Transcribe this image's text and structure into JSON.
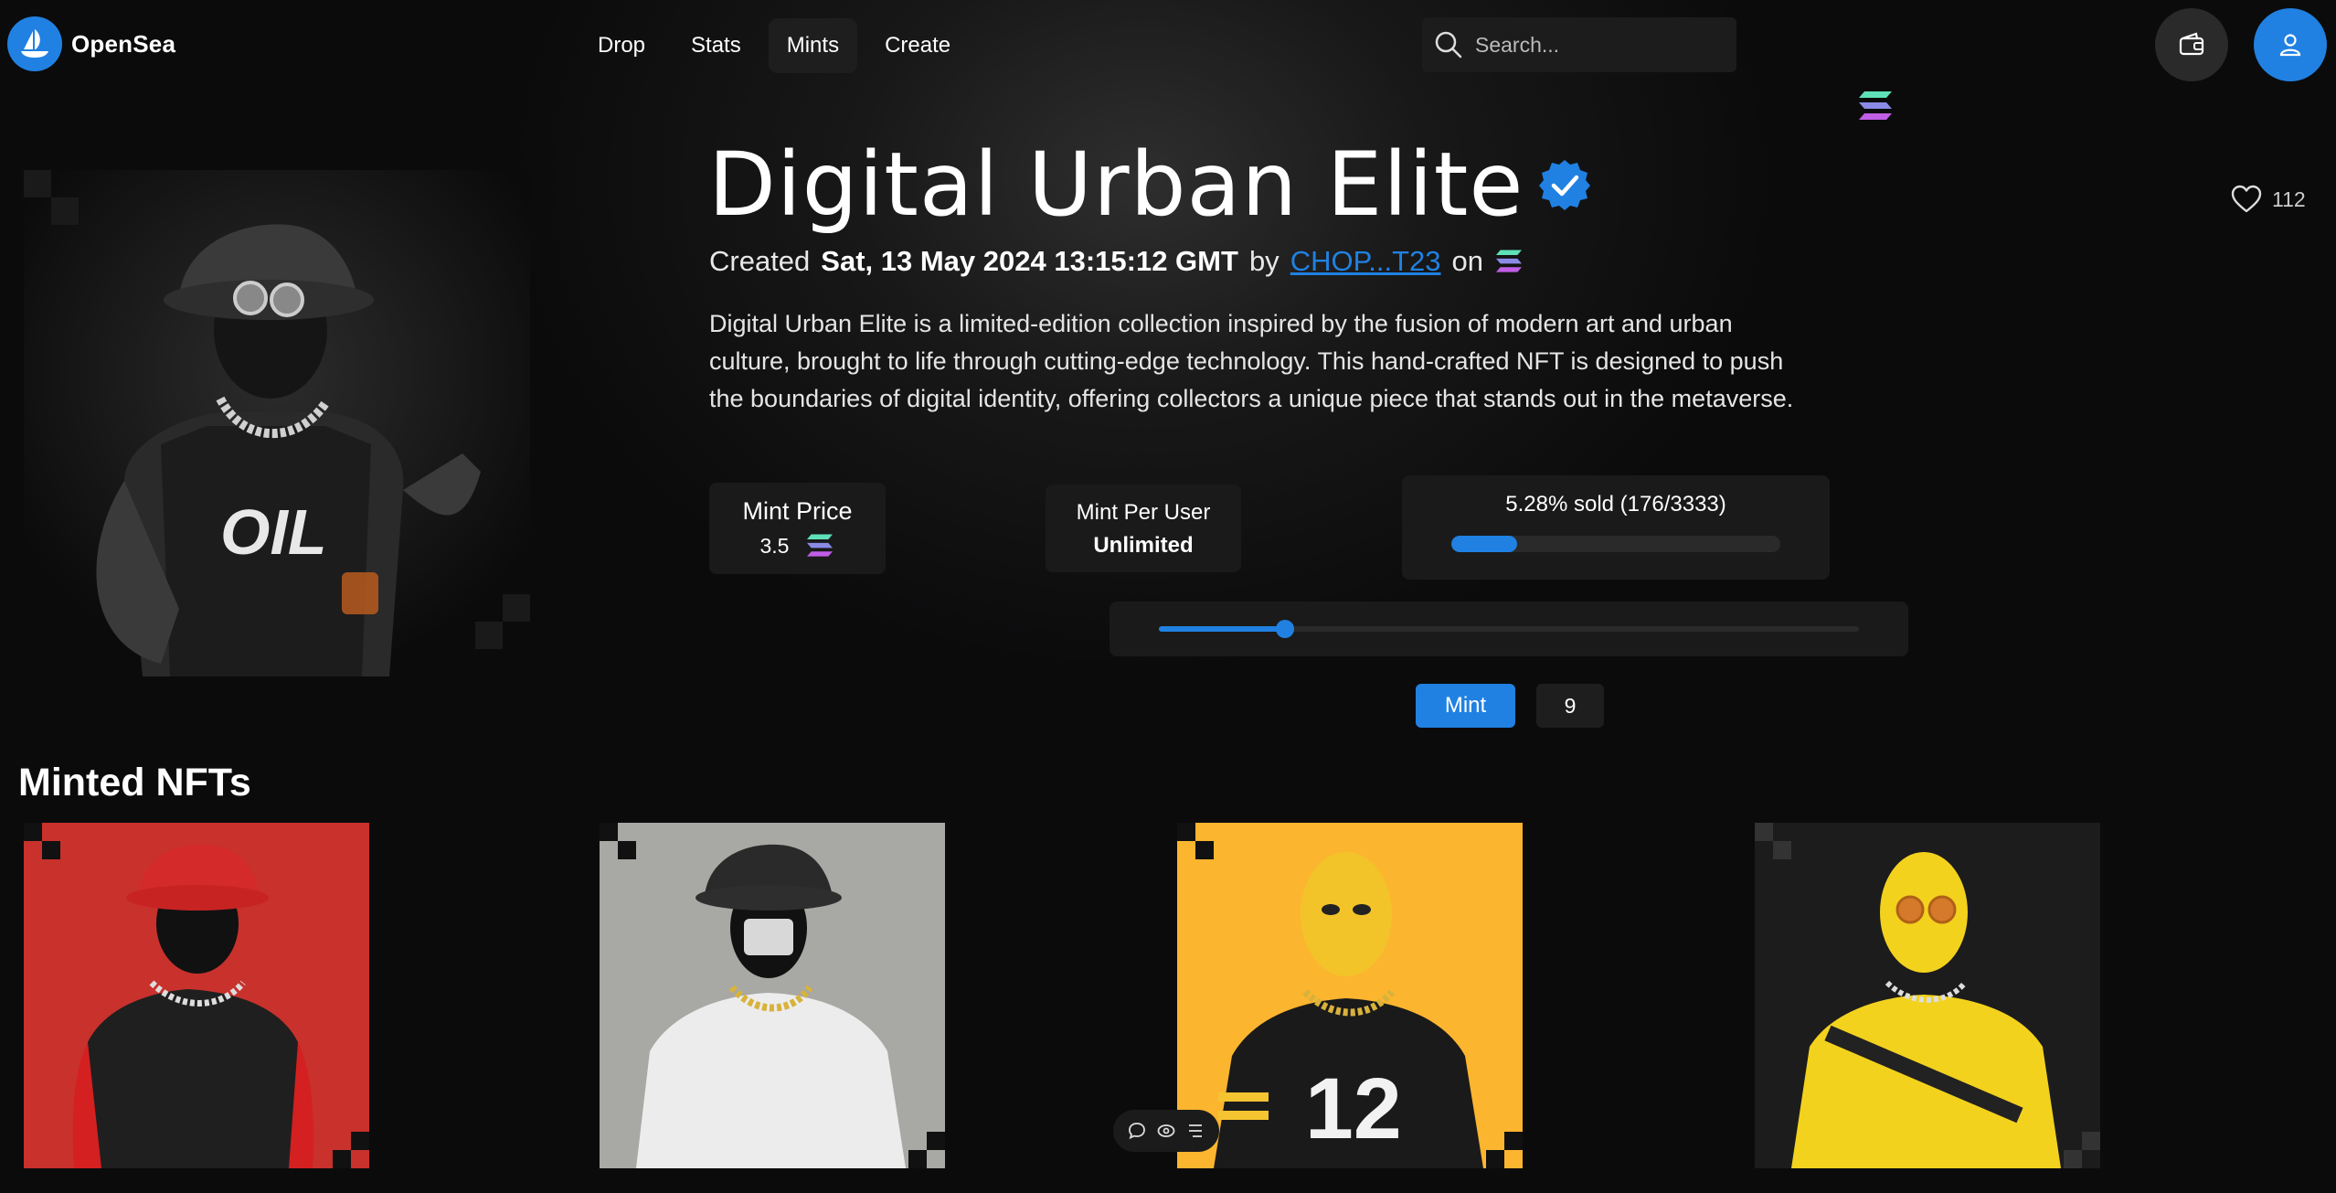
{
  "brand": {
    "name": "OpenSea",
    "accent": "#2081e2"
  },
  "nav": {
    "links": [
      "Drop",
      "Stats",
      "Mints",
      "Create"
    ],
    "active": "Mints"
  },
  "search": {
    "placeholder": "Search..."
  },
  "header_icons": [
    "wallet-icon",
    "user-icon"
  ],
  "collection": {
    "title": "Digital Urban Elite",
    "verified": true,
    "created_label": "Created",
    "created_date": "Sat, 13 May 2024 13:15:12 GMT",
    "by_label": "by",
    "creator": "CHOP...T23",
    "on_label": "on",
    "chain_icon": "solana-icon",
    "description": "Digital Urban Elite is a limited-edition collection inspired by the fusion of modern art and urban culture, brought to life through cutting-edge technology. This hand-crafted NFT is designed to push the boundaries of digital identity, offering collectors a unique piece that stands out in the metaverse.",
    "likes": "112"
  },
  "mint_price": {
    "label": "Mint Price",
    "value": "3.5"
  },
  "mint_per_user": {
    "label": "Mint Per User",
    "value": "Unlimited"
  },
  "sold": {
    "text": "5.28% sold (176/3333)",
    "fraction": 0.0528
  },
  "quantity_slider": {
    "fraction": 0.18
  },
  "mint": {
    "button_label": "Mint",
    "quantity": "9"
  },
  "minted": {
    "title": "Minted NFTs",
    "items": [
      {
        "name": "minted-nft-1",
        "bg": "#c8312c"
      },
      {
        "name": "minted-nft-2",
        "bg": "#a8a8a4"
      },
      {
        "name": "minted-nft-3",
        "bg": "#fcb52f"
      },
      {
        "name": "minted-nft-4",
        "bg": "#1c1c1c"
      }
    ]
  },
  "floating_toolbar": [
    "comment-icon",
    "eye-icon",
    "menu-icon"
  ]
}
